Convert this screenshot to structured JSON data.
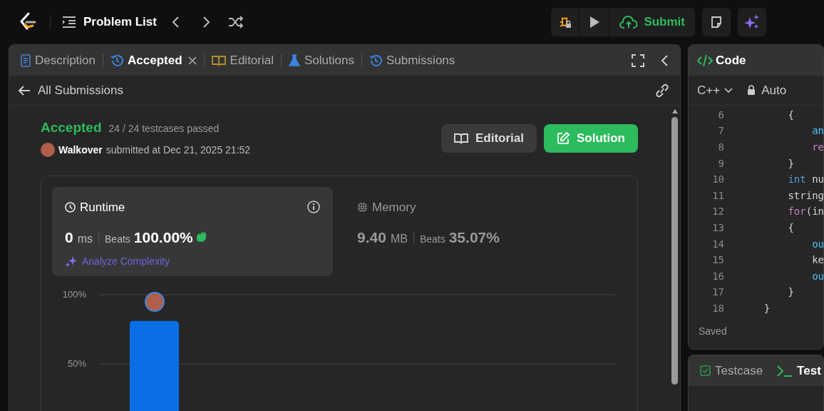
{
  "top_bar": {
    "title": "Problem List",
    "submit": "Submit"
  },
  "left_panel": {
    "tabs": [
      {
        "label": "Description",
        "selected": false,
        "closable": false
      },
      {
        "label": "Accepted",
        "selected": true,
        "closable": true
      },
      {
        "label": "Editorial",
        "selected": false,
        "closable": false
      },
      {
        "label": "Solutions",
        "selected": false,
        "closable": false
      },
      {
        "label": "Submissions",
        "selected": false,
        "closable": false
      }
    ],
    "back_link": "All Submissions",
    "status": "Accepted",
    "testcases": "24 / 24 testcases passed",
    "user": "Walkover",
    "submitted": "submitted at Dec 21, 2025 21:52",
    "buttons": [
      {
        "label": "Editorial",
        "kind": "secondary"
      },
      {
        "label": "Solution",
        "kind": "primary"
      }
    ],
    "runtime": {
      "title": "Runtime",
      "value": "0",
      "unit": "ms",
      "beats_label": "Beats",
      "beats": "100.00%",
      "analyze": "Analyze Complexity",
      "selected": true
    },
    "memory": {
      "title": "Memory",
      "value": "9.40",
      "unit": "MB",
      "beats_label": "Beats",
      "beats": "35.07%",
      "selected": false
    },
    "chart_data": {
      "type": "bar",
      "values": [
        81
      ],
      "ylim": [
        0,
        100
      ],
      "yticks": [
        {
          "value": 50,
          "label": "50%"
        },
        {
          "value": 100,
          "label": "100%"
        }
      ]
    }
  },
  "code_panel": {
    "title": "Code",
    "language": "C++",
    "mode": "Auto",
    "status": "Saved",
    "lines": [
      {
        "n": "6",
        "parts": [
          {
            "t": "        {",
            "kind": "plain"
          }
        ]
      },
      {
        "n": "7",
        "parts": [
          {
            "t": "            an",
            "kind": "ident"
          }
        ]
      },
      {
        "n": "8",
        "parts": [
          {
            "t": "            re",
            "kind": "keyword"
          }
        ]
      },
      {
        "n": "9",
        "parts": [
          {
            "t": "        }",
            "kind": "plain"
          }
        ]
      },
      {
        "n": "10",
        "parts": [
          {
            "t": "        int",
            "kind": "type"
          },
          {
            "t": " nu",
            "kind": "plain"
          }
        ]
      },
      {
        "n": "11",
        "parts": [
          {
            "t": "        string",
            "kind": "plain"
          }
        ]
      },
      {
        "n": "12",
        "parts": [
          {
            "t": "        for",
            "kind": "keyword"
          },
          {
            "t": "(in",
            "kind": "plain"
          }
        ]
      },
      {
        "n": "13",
        "parts": [
          {
            "t": "        {",
            "kind": "plain"
          }
        ]
      },
      {
        "n": "14",
        "parts": [
          {
            "t": "            ou",
            "kind": "ident"
          }
        ]
      },
      {
        "n": "15",
        "parts": [
          {
            "t": "            ke",
            "kind": "plain"
          }
        ]
      },
      {
        "n": "16",
        "parts": [
          {
            "t": "            ou",
            "kind": "ident"
          }
        ]
      },
      {
        "n": "17",
        "parts": [
          {
            "t": "        }",
            "kind": "plain"
          }
        ]
      },
      {
        "n": "18",
        "parts": [
          {
            "t": "    }",
            "kind": "plain"
          }
        ]
      }
    ]
  },
  "test_panel": {
    "tabs": [
      {
        "label": "Testcase",
        "selected": false
      },
      {
        "label": "Test",
        "selected": true
      }
    ]
  }
}
